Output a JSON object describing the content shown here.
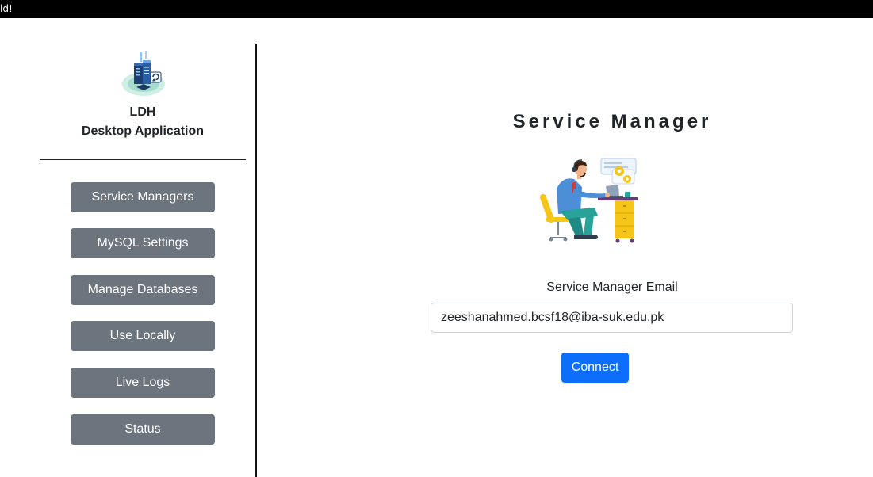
{
  "window": {
    "title_fragment": "ld!"
  },
  "sidebar": {
    "logo_icon": "server-database-icon",
    "brand_line1": "LDH",
    "brand_line2": "Desktop Application",
    "items": [
      {
        "label": "Service Managers"
      },
      {
        "label": "MySQL Settings"
      },
      {
        "label": "Manage Databases"
      },
      {
        "label": "Use Locally"
      },
      {
        "label": "Live Logs"
      },
      {
        "label": "Status"
      }
    ]
  },
  "main": {
    "title": "Service Manager",
    "illustration": "person-working-at-desk-illustration",
    "email_label": "Service Manager Email",
    "email_value": "zeeshanahmed.bcsf18@iba-suk.edu.pk",
    "connect_label": "Connect"
  },
  "colors": {
    "nav_button": "#6c757d",
    "primary_button": "#0d6efd",
    "title_bar": "#000000"
  }
}
